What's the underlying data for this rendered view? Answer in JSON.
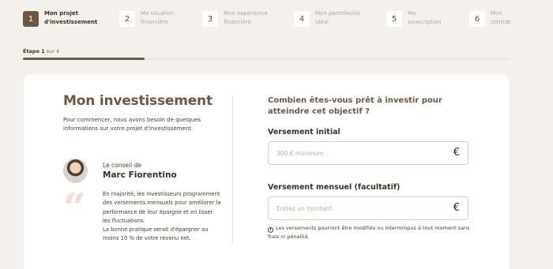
{
  "stepper": {
    "steps": [
      {
        "number": "1",
        "line1": "Mon projet",
        "line2": "d'investissement"
      },
      {
        "number": "2",
        "line1": "Ma situation",
        "line2": "financière"
      },
      {
        "number": "3",
        "line1": "Mon expérience",
        "line2": "financière"
      },
      {
        "number": "4",
        "line1": "Mon portefeuille",
        "line2": "idéal"
      },
      {
        "number": "5",
        "line1": "Ma",
        "line2": "souscription"
      },
      {
        "number": "6",
        "line1": "Mon",
        "line2": "contrat"
      }
    ],
    "active_step": 1
  },
  "progress": {
    "step_label": "Étape",
    "current": "1",
    "of_label": "sur 4",
    "fraction": 0.25
  },
  "left": {
    "title": "Mon investissement",
    "intro": "Pour commencer, nous avons besoin de quelques informations sur votre projet d'investissement.",
    "advisor_kicker": "Le conseil de",
    "advisor_name": "Marc Fiorentino",
    "quote_mark": "“",
    "advice": "En majorité, les investisseurs programment des versements mensuels pour améliorer la performance de leur épargne et en lisser les fluctuations.\nLa bonne pratique serait d'épargner au moins 10 % de votre revenu net."
  },
  "form": {
    "question": "Combien êtes-vous prêt à investir pour atteindre cet objectif ?",
    "initial": {
      "label": "Versement initial",
      "placeholder": "300 € minimum",
      "value": "",
      "currency": "€"
    },
    "monthly": {
      "label": "Versement mensuel (facultatif)",
      "placeholder": "Entrez un montant",
      "value": "",
      "currency": "€"
    },
    "note_icon": "i",
    "note": "Les versements pourront être modifiés ou interrompus à tout moment sans frais ni pénalité."
  },
  "colors": {
    "accent": "#6e5845",
    "background": "#f4f1ec",
    "quote": "#f6d9cf"
  },
  "icons": [
    "info-icon",
    "euro-icon",
    "quote-icon"
  ]
}
